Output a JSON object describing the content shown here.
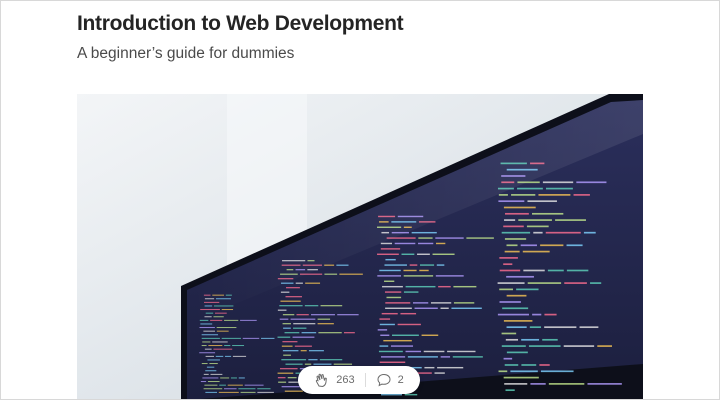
{
  "article": {
    "title": "Introduction to Web Development",
    "subtitle": "A beginner’s guide for dummies"
  },
  "hero": {
    "image_description": "photo of a curved monitor displaying code in a dark theme"
  },
  "actions": {
    "clap_icon": "clap-icon",
    "clap_count": "263",
    "response_icon": "comment-icon",
    "response_count": "2"
  }
}
